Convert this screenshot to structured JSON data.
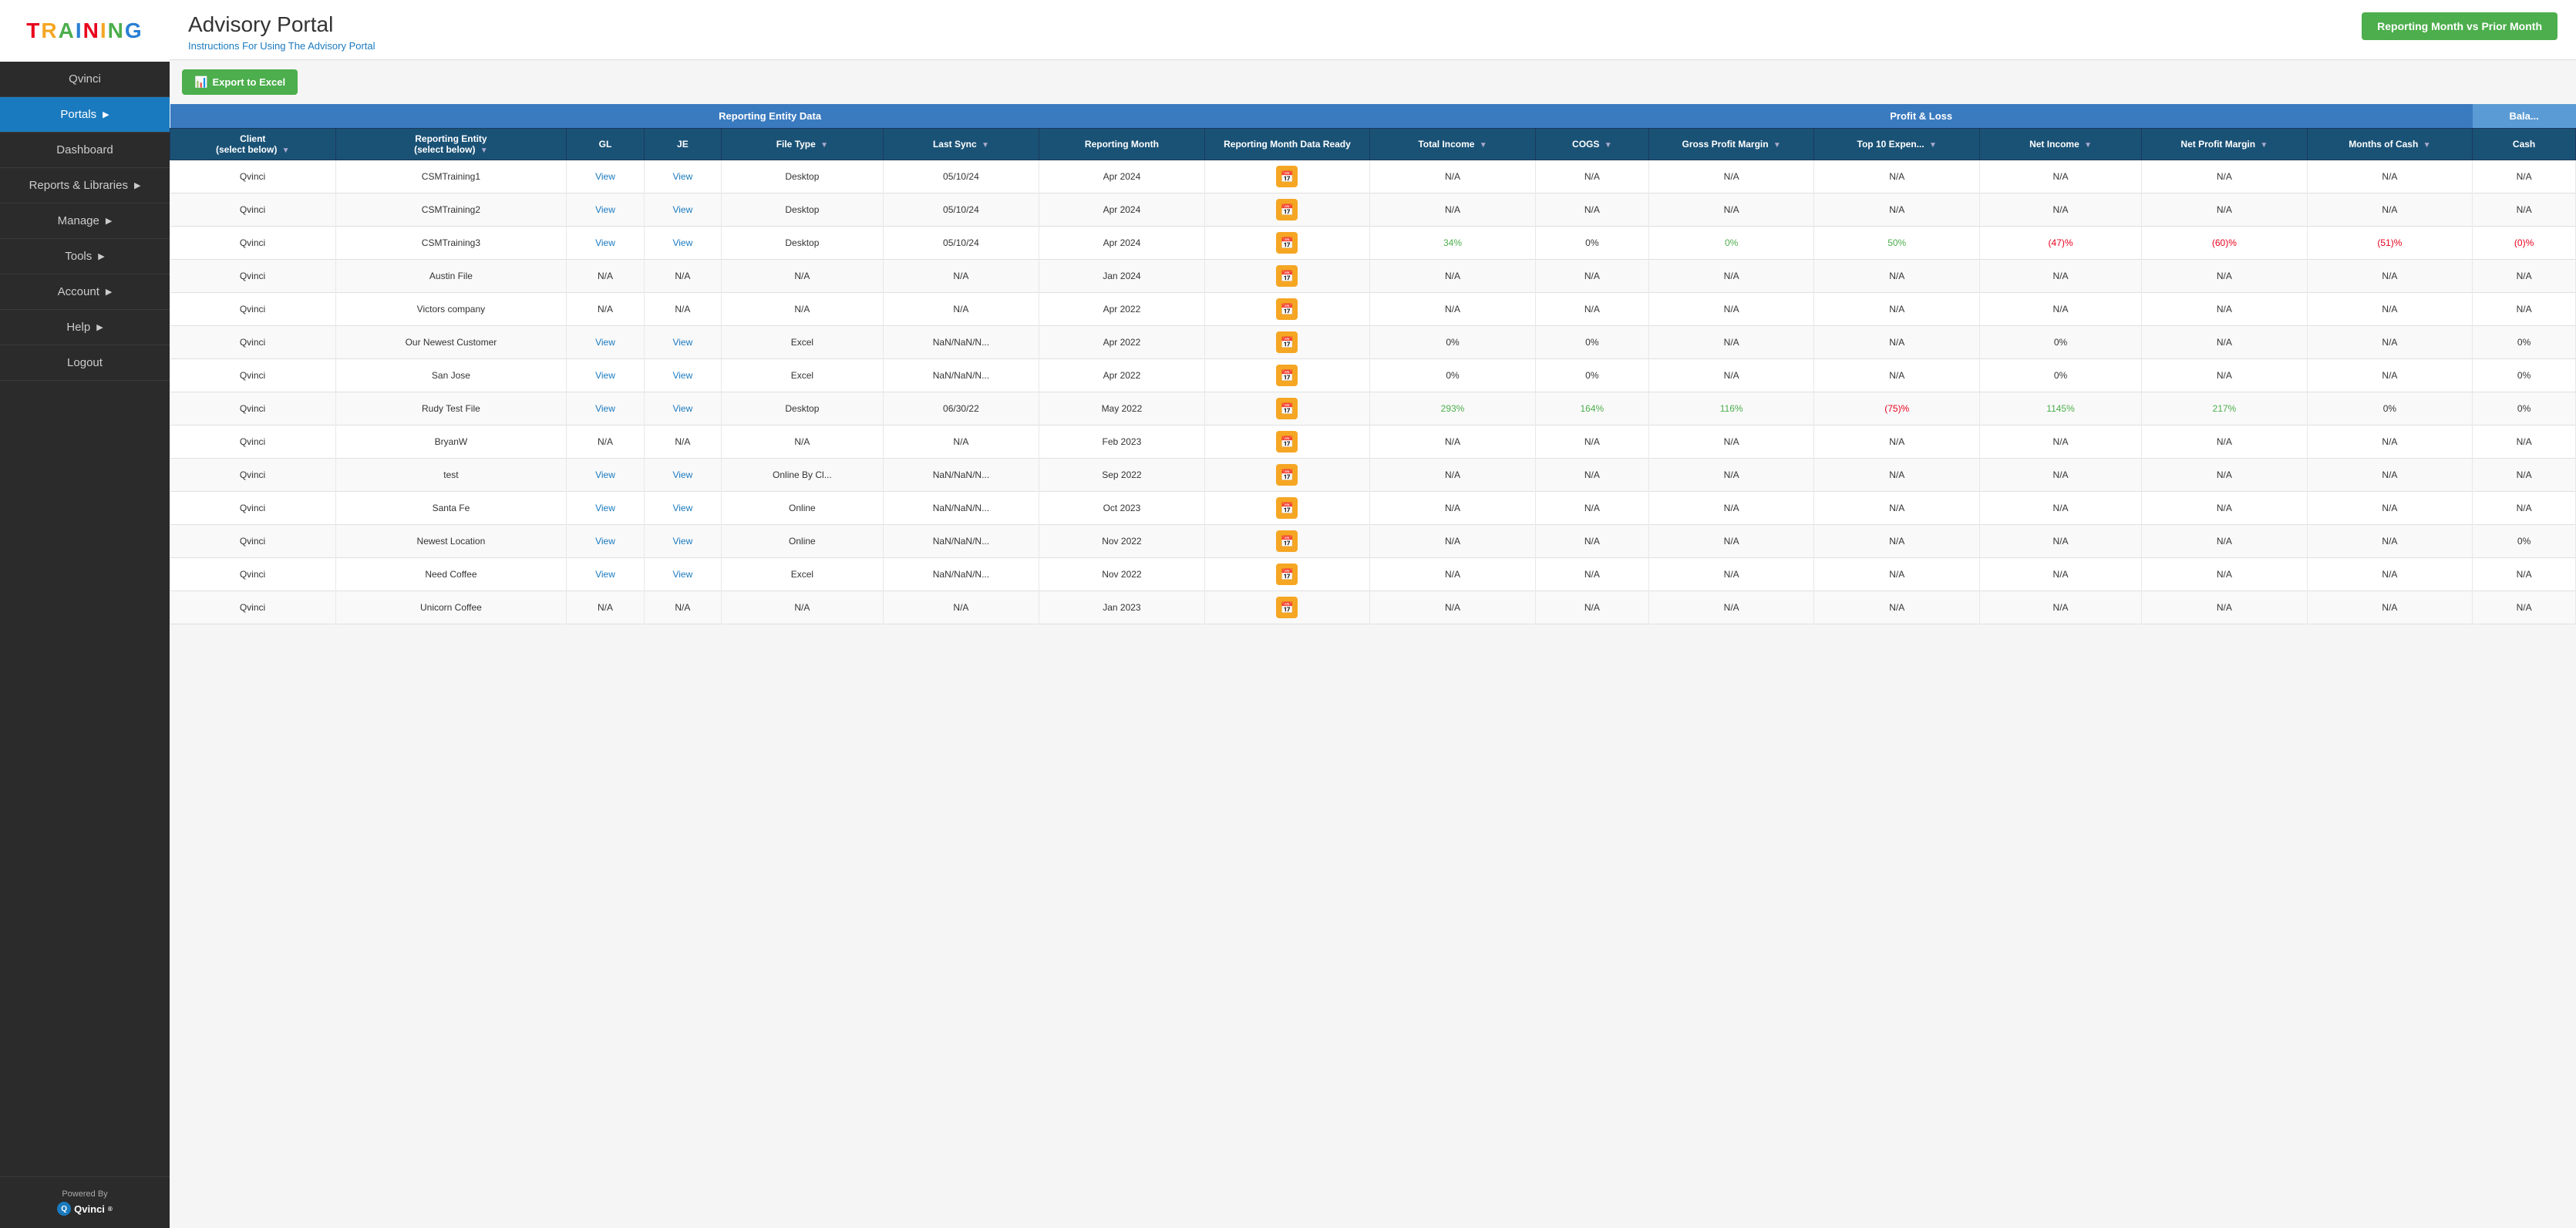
{
  "sidebar": {
    "logo": "TRAINING",
    "items": [
      {
        "label": "Qvinci",
        "active": false,
        "arrow": false
      },
      {
        "label": "Portals",
        "active": true,
        "arrow": true
      },
      {
        "label": "Dashboard",
        "active": false,
        "arrow": false
      },
      {
        "label": "Reports & Libraries",
        "active": false,
        "arrow": true
      },
      {
        "label": "Manage",
        "active": false,
        "arrow": true
      },
      {
        "label": "Tools",
        "active": false,
        "arrow": true
      },
      {
        "label": "Account",
        "active": false,
        "arrow": true
      },
      {
        "label": "Help",
        "active": false,
        "arrow": true
      },
      {
        "label": "Logout",
        "active": false,
        "arrow": false
      }
    ],
    "poweredBy": "Powered By",
    "brand": "Qvinci"
  },
  "header": {
    "title": "Advisory Portal",
    "link": "Instructions For Using The Advisory Portal",
    "reportBtn": "Reporting Month vs Prior Month"
  },
  "toolbar": {
    "exportBtn": "Export to Excel"
  },
  "table": {
    "sections": [
      {
        "label": "Reporting Entity Data",
        "colspan": 8
      },
      {
        "label": "Profit & Loss",
        "colspan": 7
      },
      {
        "label": "Bala...",
        "colspan": 2
      }
    ],
    "columns": [
      {
        "label": "Client\n(select below)",
        "filter": true
      },
      {
        "label": "Reporting Entity\n(select below)",
        "filter": true
      },
      {
        "label": "GL",
        "filter": false
      },
      {
        "label": "JE",
        "filter": false
      },
      {
        "label": "File Type",
        "filter": true
      },
      {
        "label": "Last Sync",
        "filter": true
      },
      {
        "label": "Reporting Month",
        "filter": false
      },
      {
        "label": "Reporting Month Data Ready",
        "filter": false
      },
      {
        "label": "Total Income",
        "filter": true
      },
      {
        "label": "COGS",
        "filter": true
      },
      {
        "label": "Gross Profit Margin",
        "filter": true
      },
      {
        "label": "Top 10 Expen...",
        "filter": true
      },
      {
        "label": "Net Income",
        "filter": true
      },
      {
        "label": "Net Profit Margin",
        "filter": true
      },
      {
        "label": "Months of Cash",
        "filter": true
      },
      {
        "label": "Cash",
        "filter": false
      }
    ],
    "rows": [
      {
        "client": "Qvinci",
        "entity": "CSMTraining1",
        "gl": "View",
        "je": "View",
        "fileType": "Desktop",
        "lastSync": "05/10/24",
        "repMonth": "Apr 2024",
        "dataReady": "calendar",
        "totalIncome": "N/A",
        "cogs": "N/A",
        "grossProfit": "N/A",
        "top10": "N/A",
        "netIncome": "N/A",
        "netProfitMargin": "N/A",
        "monthsCash": "N/A",
        "cash": "N/A"
      },
      {
        "client": "Qvinci",
        "entity": "CSMTraining2",
        "gl": "View",
        "je": "View",
        "fileType": "Desktop",
        "lastSync": "05/10/24",
        "repMonth": "Apr 2024",
        "dataReady": "calendar",
        "totalIncome": "N/A",
        "cogs": "N/A",
        "grossProfit": "N/A",
        "top10": "N/A",
        "netIncome": "N/A",
        "netProfitMargin": "N/A",
        "monthsCash": "N/A",
        "cash": "N/A"
      },
      {
        "client": "Qvinci",
        "entity": "CSMTraining3",
        "gl": "View",
        "je": "View",
        "fileType": "Desktop",
        "lastSync": "05/10/24",
        "repMonth": "Apr 2024",
        "dataReady": "calendar",
        "totalIncome": "34%",
        "totalIncomeClass": "positive",
        "cogs": "0%",
        "cogsClass": "neutral",
        "grossProfit": "0%",
        "grossProfitClass": "positive",
        "top10": "50%",
        "top10Class": "positive",
        "netIncome": "(47)%",
        "netIncomeClass": "negative",
        "netProfitMargin": "(60)%",
        "netProfitMarginClass": "negative",
        "monthsCash": "(51)%",
        "monthsCashClass": "negative",
        "cash": "(0)%",
        "cashClass": "negative"
      },
      {
        "client": "Qvinci",
        "entity": "Austin File",
        "gl": "N/A",
        "je": "N/A",
        "fileType": "N/A",
        "lastSync": "N/A",
        "repMonth": "Jan 2024",
        "dataReady": "calendar",
        "totalIncome": "N/A",
        "cogs": "N/A",
        "grossProfit": "N/A",
        "top10": "N/A",
        "netIncome": "N/A",
        "netProfitMargin": "N/A",
        "monthsCash": "N/A",
        "cash": "N/A"
      },
      {
        "client": "Qvinci",
        "entity": "Victors company",
        "gl": "N/A",
        "je": "N/A",
        "fileType": "N/A",
        "lastSync": "N/A",
        "repMonth": "Apr 2022",
        "dataReady": "calendar",
        "totalIncome": "N/A",
        "cogs": "N/A",
        "grossProfit": "N/A",
        "top10": "N/A",
        "netIncome": "N/A",
        "netProfitMargin": "N/A",
        "monthsCash": "N/A",
        "cash": "N/A"
      },
      {
        "client": "Qvinci",
        "entity": "Our Newest Customer",
        "gl": "View",
        "je": "View",
        "fileType": "Excel",
        "lastSync": "NaN/NaN/N...",
        "repMonth": "Apr 2022",
        "dataReady": "calendar",
        "totalIncome": "0%",
        "totalIncomeClass": "neutral",
        "cogs": "0%",
        "cogsClass": "neutral",
        "grossProfit": "N/A",
        "top10": "N/A",
        "netIncome": "0%",
        "netIncomeClass": "neutral",
        "netProfitMargin": "N/A",
        "monthsCash": "N/A",
        "cash": "0%",
        "cashClass": "neutral"
      },
      {
        "client": "Qvinci",
        "entity": "San Jose",
        "gl": "View",
        "je": "View",
        "fileType": "Excel",
        "lastSync": "NaN/NaN/N...",
        "repMonth": "Apr 2022",
        "dataReady": "calendar",
        "totalIncome": "0%",
        "totalIncomeClass": "neutral",
        "cogs": "0%",
        "cogsClass": "neutral",
        "grossProfit": "N/A",
        "top10": "N/A",
        "netIncome": "0%",
        "netIncomeClass": "neutral",
        "netProfitMargin": "N/A",
        "monthsCash": "N/A",
        "cash": "0%",
        "cashClass": "neutral"
      },
      {
        "client": "Qvinci",
        "entity": "Rudy Test File",
        "gl": "View",
        "je": "View",
        "fileType": "Desktop",
        "lastSync": "06/30/22",
        "repMonth": "May 2022",
        "dataReady": "calendar",
        "totalIncome": "293%",
        "totalIncomeClass": "positive",
        "cogs": "164%",
        "cogsClass": "positive",
        "grossProfit": "116%",
        "grossProfitClass": "positive",
        "top10": "(75)%",
        "top10Class": "negative",
        "netIncome": "1145%",
        "netIncomeClass": "positive",
        "netProfitMargin": "217%",
        "netProfitMarginClass": "positive",
        "monthsCash": "0%",
        "monthsCashClass": "neutral",
        "cash": "0%",
        "cashClass": "neutral"
      },
      {
        "client": "Qvinci",
        "entity": "BryanW",
        "gl": "N/A",
        "je": "N/A",
        "fileType": "N/A",
        "lastSync": "N/A",
        "repMonth": "Feb 2023",
        "dataReady": "calendar",
        "totalIncome": "N/A",
        "cogs": "N/A",
        "grossProfit": "N/A",
        "top10": "N/A",
        "netIncome": "N/A",
        "netProfitMargin": "N/A",
        "monthsCash": "N/A",
        "cash": "N/A"
      },
      {
        "client": "Qvinci",
        "entity": "test",
        "gl": "View",
        "je": "View",
        "fileType": "Online By Cl...",
        "lastSync": "NaN/NaN/N...",
        "repMonth": "Sep 2022",
        "dataReady": "calendar",
        "totalIncome": "N/A",
        "cogs": "N/A",
        "grossProfit": "N/A",
        "top10": "N/A",
        "netIncome": "N/A",
        "netProfitMargin": "N/A",
        "monthsCash": "N/A",
        "cash": "N/A"
      },
      {
        "client": "Qvinci",
        "entity": "Santa Fe",
        "gl": "View",
        "je": "View",
        "fileType": "Online",
        "lastSync": "NaN/NaN/N...",
        "repMonth": "Oct 2023",
        "dataReady": "calendar",
        "totalIncome": "N/A",
        "cogs": "N/A",
        "grossProfit": "N/A",
        "top10": "N/A",
        "netIncome": "N/A",
        "netProfitMargin": "N/A",
        "monthsCash": "N/A",
        "cash": "N/A"
      },
      {
        "client": "Qvinci",
        "entity": "Newest Location",
        "gl": "View",
        "je": "View",
        "fileType": "Online",
        "lastSync": "NaN/NaN/N...",
        "repMonth": "Nov 2022",
        "dataReady": "calendar",
        "totalIncome": "N/A",
        "cogs": "N/A",
        "grossProfit": "N/A",
        "top10": "N/A",
        "netIncome": "N/A",
        "netProfitMargin": "N/A",
        "monthsCash": "N/A",
        "cash": "0%",
        "cashClass": "neutral"
      },
      {
        "client": "Qvinci",
        "entity": "Need Coffee",
        "gl": "View",
        "je": "View",
        "fileType": "Excel",
        "lastSync": "NaN/NaN/N...",
        "repMonth": "Nov 2022",
        "dataReady": "calendar",
        "totalIncome": "N/A",
        "cogs": "N/A",
        "grossProfit": "N/A",
        "top10": "N/A",
        "netIncome": "N/A",
        "netProfitMargin": "N/A",
        "monthsCash": "N/A",
        "cash": "N/A"
      },
      {
        "client": "Qvinci",
        "entity": "Unicorn Coffee",
        "gl": "N/A",
        "je": "N/A",
        "fileType": "N/A",
        "lastSync": "N/A",
        "repMonth": "Jan 2023",
        "dataReady": "calendar",
        "totalIncome": "N/A",
        "cogs": "N/A",
        "grossProfit": "N/A",
        "top10": "N/A",
        "netIncome": "N/A",
        "netProfitMargin": "N/A",
        "monthsCash": "N/A",
        "cash": "N/A"
      }
    ]
  }
}
